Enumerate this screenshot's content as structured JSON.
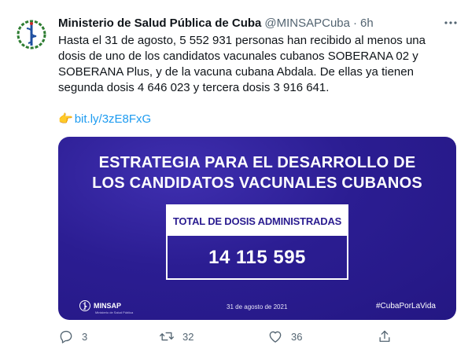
{
  "tweet": {
    "author_name": "Ministerio de Salud Pública de Cuba",
    "handle": "@MINSAPCuba",
    "separator": "·",
    "time": "6h",
    "text": "Hasta el 31 de agosto, 5 552 931 personas han recibido al menos una dosis de uno de los candidatos vacunales cubanos SOBERANA 02 y SOBERANA Plus, y de la vacuna cubana Abdala. De ellas ya tienen segunda dosis 4 646 023 y tercera dosis 3 916 641.",
    "link_emoji": "👉",
    "link": "bit.ly/3zE8FxG"
  },
  "card": {
    "title_line1": "ESTRATEGIA PARA EL DESARROLLO DE",
    "title_line2": "LOS CANDIDATOS VACUNALES CUBANOS",
    "dose_label": "TOTAL DE DOSIS ADMINISTRADAS",
    "dose_value": "14 115 595",
    "logo_text": "MINSAP",
    "logo_subtext": "Ministerio de Salud Pública",
    "date": "31 de agosto de 2021",
    "hashtag": "#CubaPorLaVida"
  },
  "actions": {
    "replies": "3",
    "retweets": "32",
    "likes": "36"
  },
  "colors": {
    "link": "#1d9bf0",
    "card_bg": "#2b1d92",
    "muted": "#536471"
  }
}
